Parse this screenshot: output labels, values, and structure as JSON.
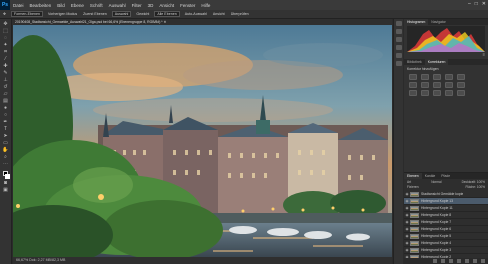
{
  "app": {
    "logo_text": "Ps"
  },
  "menu": [
    "Datei",
    "Bearbeiten",
    "Bild",
    "Ebene",
    "Schrift",
    "Auswahl",
    "Filter",
    "3D",
    "Ansicht",
    "Fenster",
    "Hilfe"
  ],
  "window_controls": [
    "–",
    "□",
    "✕"
  ],
  "options": {
    "items": [
      "Formen-Ebenen",
      "Vorherigen Modus",
      "Zuerst Ebenen",
      "Auswahl",
      "Gewicht",
      "Alle Ebenen",
      "Auto-Auswahl",
      "Ansicht",
      "Überprüfen"
    ]
  },
  "document": {
    "tab_title": "20190408_Stadtansicht_Gemaelde_Auswahl21_Olga.psd bei 66,6% (Ebenengruppe 8, RGB/8#) * ✕"
  },
  "status": {
    "text": "66,67%    Dok: 2,27 MB/82,3 MB"
  },
  "panels": {
    "top_tabs": [
      "Histogramm",
      "Navigator"
    ],
    "histogram_menu": "≡",
    "adjust_tabs": [
      "Bibliothek",
      "Korrekturen"
    ],
    "adjust_title": "Korrektur hinzufügen"
  },
  "layers": {
    "tabs": [
      "Ebenen",
      "Kanäle",
      "Pfade"
    ],
    "filter_label": "Art",
    "mode": "Normal",
    "opacity_label": "Deckkraft: 100%",
    "lock_label": "Fixieren:",
    "fill_label": "Fläche: 100%",
    "items": [
      {
        "name": "Stadtansicht Gemälde kopie",
        "selected": false,
        "white": false
      },
      {
        "name": "Hintergrund Kopie 13",
        "selected": true,
        "white": false
      },
      {
        "name": "Hintergrund Kopie 11",
        "selected": false,
        "white": false
      },
      {
        "name": "Hintergrund Kopie 8",
        "selected": false,
        "white": false
      },
      {
        "name": "Hintergrund Kopie 7",
        "selected": false,
        "white": false
      },
      {
        "name": "Hintergrund Kopie 6",
        "selected": false,
        "white": false
      },
      {
        "name": "Hintergrund Kopie 5",
        "selected": false,
        "white": false
      },
      {
        "name": "Hintergrund Kopie 4",
        "selected": false,
        "white": false
      },
      {
        "name": "Hintergrund Kopie 3",
        "selected": false,
        "white": false
      },
      {
        "name": "Hintergrund Kopie 2",
        "selected": false,
        "white": false
      },
      {
        "name": "Hintergrund",
        "selected": false,
        "white": true
      }
    ]
  },
  "colors": {
    "accent": "#31a8ff",
    "ps_logo_bg": "#001e36"
  }
}
